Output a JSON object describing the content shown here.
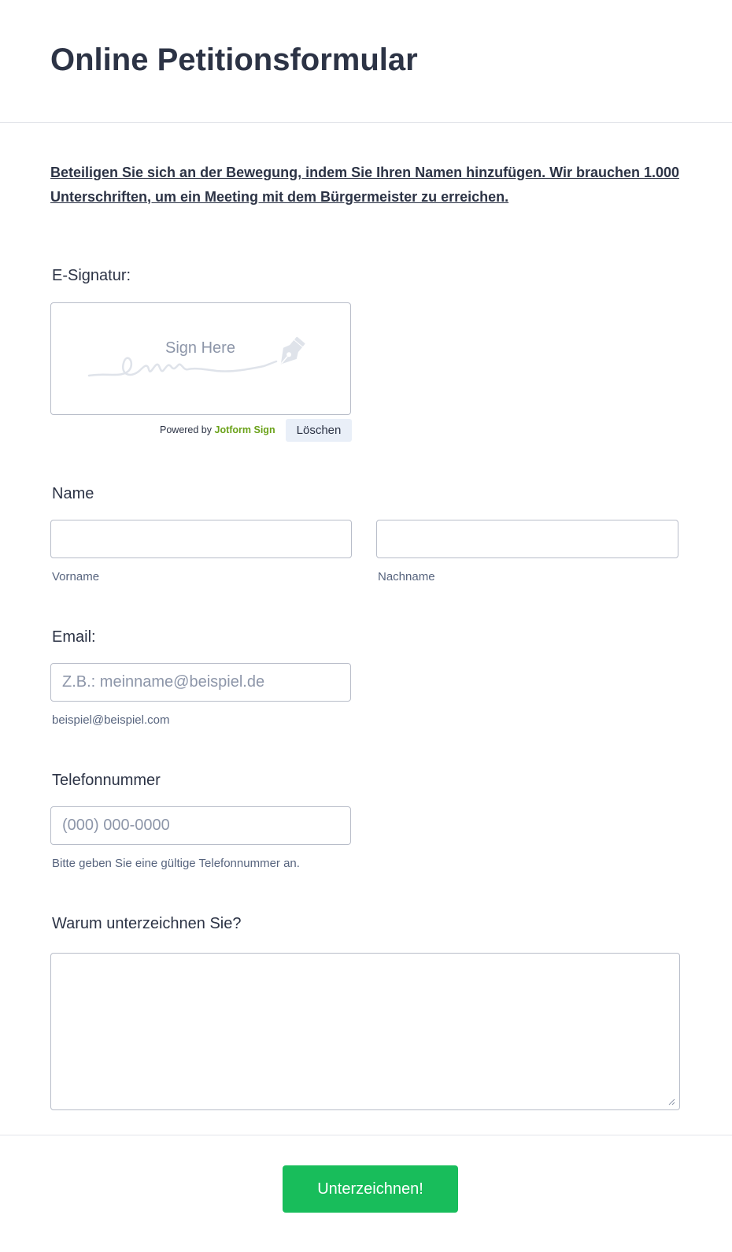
{
  "header": {
    "title": "Online Petitionsformular"
  },
  "intro": {
    "text": "Beteiligen Sie sich an der Bewegung, indem Sie Ihren Namen hinzufügen. Wir brauchen 1.000 Unterschriften, um ein Meeting mit dem Bürgermeister zu erreichen."
  },
  "signature": {
    "label": "E-Signatur:",
    "placeholder": "Sign Here",
    "icon": "pen-nib-icon",
    "powered_prefix": "Powered by",
    "powered_brand": "Jotform Sign",
    "clear_label": "Löschen"
  },
  "name": {
    "label": "Name",
    "first_value": "",
    "first_sublabel": "Vorname",
    "last_value": "",
    "last_sublabel": "Nachname"
  },
  "email": {
    "label": "Email:",
    "value": "",
    "placeholder": "Z.B.: meinname@beispiel.de",
    "sublabel": "beispiel@beispiel.com"
  },
  "phone": {
    "label": "Telefonnummer",
    "value": "",
    "placeholder": "(000) 000-0000",
    "sublabel": "Bitte geben Sie eine gültige Telefonnummer an."
  },
  "reason": {
    "label": "Warum unterzeichnen Sie?",
    "value": ""
  },
  "submit": {
    "label": "Unterzeichnen!"
  },
  "colors": {
    "text": "#2c3345",
    "submit_bg": "#18bd5b",
    "brand_green": "#6ba21a",
    "border": "#b8bdc9"
  }
}
